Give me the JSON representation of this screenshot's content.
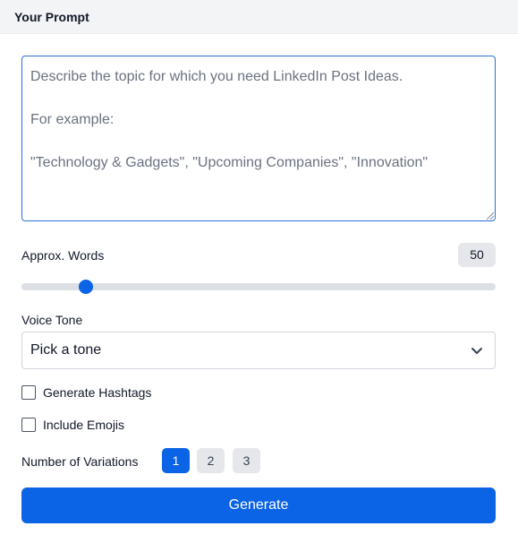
{
  "header": {
    "title": "Your Prompt"
  },
  "prompt": {
    "placeholder": "Describe the topic for which you need LinkedIn Post Ideas.\n\nFor example:\n\n\"Technology & Gadgets\", \"Upcoming Companies\", \"Innovation\"",
    "value": ""
  },
  "words": {
    "label": "Approx. Words",
    "value": "50",
    "slider_fraction": 0.135
  },
  "tone": {
    "label": "Voice Tone",
    "selected": "Pick a tone"
  },
  "options": [
    {
      "label": "Generate Hashtags",
      "checked": false
    },
    {
      "label": "Include Emojis",
      "checked": false
    }
  ],
  "variations": {
    "label": "Number of Variations",
    "choices": [
      "1",
      "2",
      "3"
    ],
    "selected": "1"
  },
  "generate": {
    "label": "Generate"
  },
  "colors": {
    "accent": "#0b63e5",
    "focus_border": "#2a6fd6"
  }
}
